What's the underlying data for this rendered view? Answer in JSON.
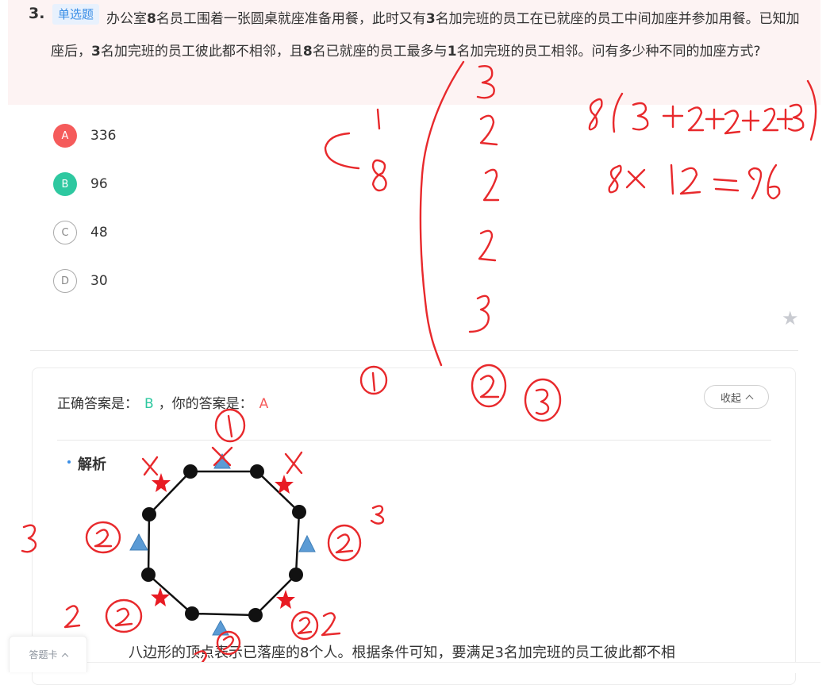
{
  "question": {
    "number": "3.",
    "type_tag": "单选题",
    "stem_parts": [
      {
        "t": "办公室",
        "b": false
      },
      {
        "t": "8",
        "b": true
      },
      {
        "t": "名员工围着一张圆桌就座准备用餐，此时又有",
        "b": false
      },
      {
        "t": "3",
        "b": true
      },
      {
        "t": "名加完班的员工在已就座的员工中间加座并参加用餐。已知加座后，",
        "b": false
      },
      {
        "t": "3",
        "b": true
      },
      {
        "t": "名加完班的员工彼此都不相邻，且",
        "b": false
      },
      {
        "t": "8",
        "b": true
      },
      {
        "t": "名已就座的员工最多与",
        "b": false
      },
      {
        "t": "1",
        "b": true
      },
      {
        "t": "名加完班的员工相邻。问有多少种不同的加座方式?",
        "b": false
      }
    ]
  },
  "options": [
    {
      "letter": "A",
      "text": "336",
      "state": "wrong"
    },
    {
      "letter": "B",
      "text": "96",
      "state": "right"
    },
    {
      "letter": "C",
      "text": "48",
      "state": "plain"
    },
    {
      "letter": "D",
      "text": "30",
      "state": "plain"
    }
  ],
  "answer": {
    "correct_label": "正确答案是：",
    "correct_value": "B",
    "separator": "，你的答案是：",
    "user_value": "A",
    "collapse_label": "收起"
  },
  "analysis": {
    "title": "解析",
    "text": "八边形的顶点表示已落座的8个人。根据条件可知，要满足3名加完班的员工彼此都不相"
  },
  "answer_sheet": {
    "label": "答题卡"
  },
  "colors": {
    "wrong": "#f55b5b",
    "right": "#2ec8a0",
    "accent": "#3a8ee6",
    "header_bg": "#fdf3f3",
    "ink": "#e8292c"
  },
  "icons": [
    "star-icon",
    "chevron-up-icon"
  ]
}
